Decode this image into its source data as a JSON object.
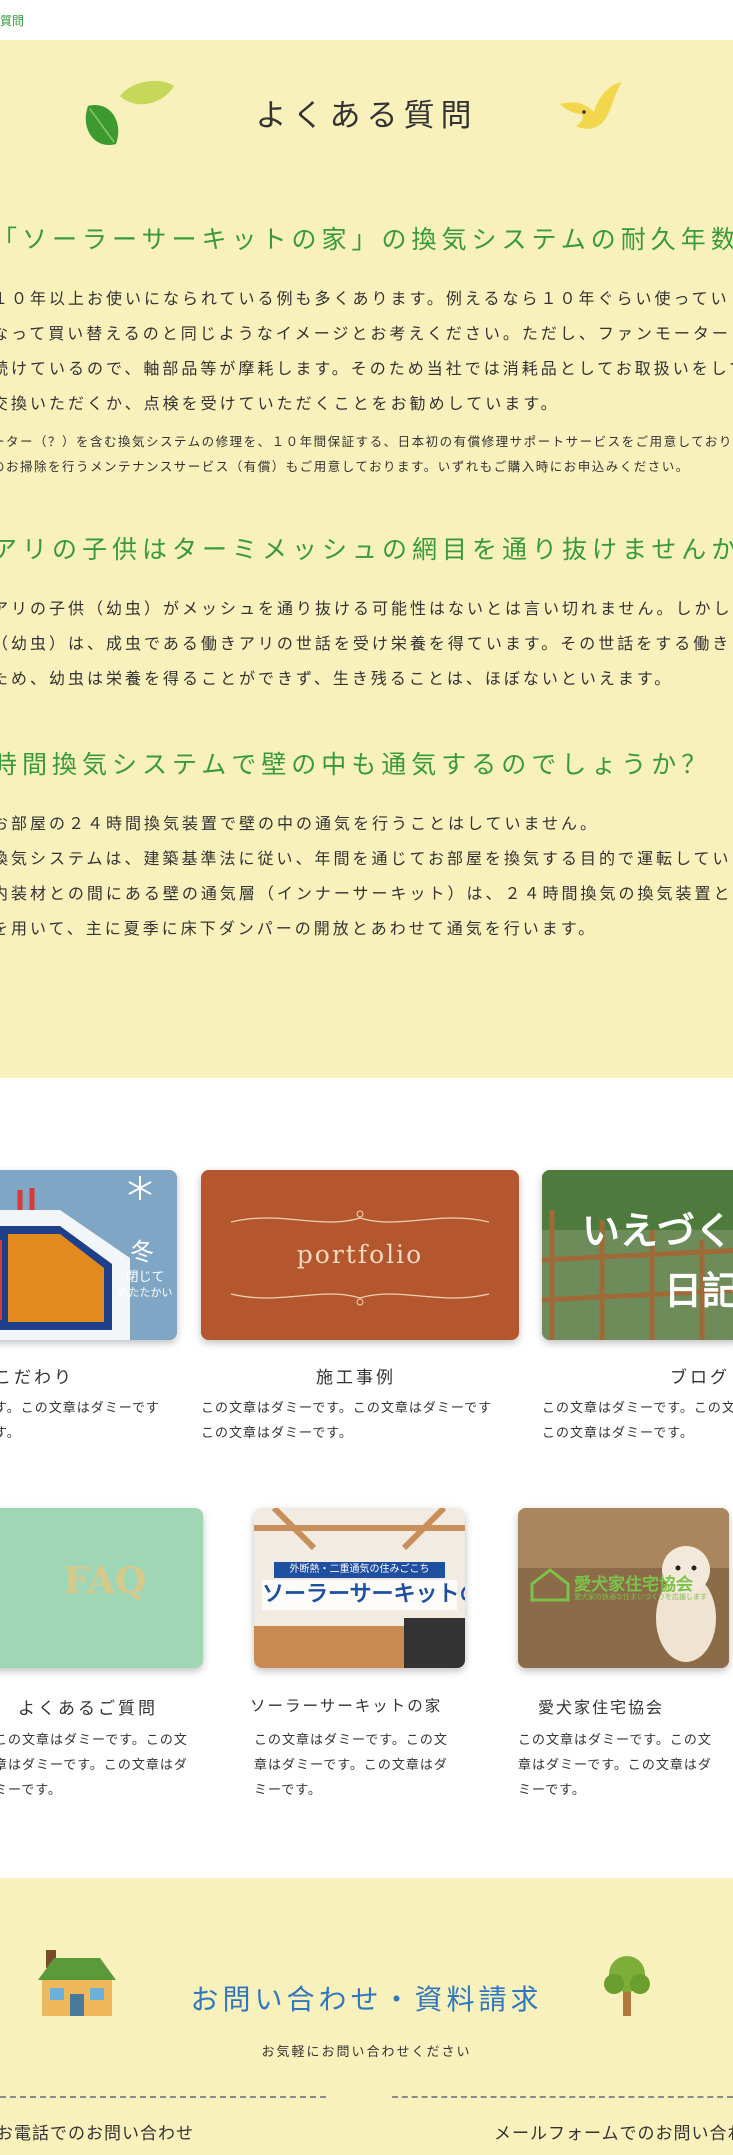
{
  "breadcrumb": "質問",
  "page_title": "よくある質問",
  "faqs": [
    {
      "question": "「ソーラーサーキットの家」の換気システムの耐久年数は？",
      "answer_lines": [
        "１０年以上お使いになられている例も多くあります。例えるなら１０年ぐらい使ってい",
        "なって買い替えるのと同じようなイメージとお考えください。ただし、ファンモーター",
        "続けているので、軸部品等が摩耗します。そのため当社では消耗品としてお取扱いをして",
        "交換いただくか、点検を受けていただくことをお勧めしています。"
      ],
      "note_lines": [
        "ーター（？）を含む換気システムの修理を、１０年間保証する、日本初の有償修理サポートサービスをご用意しております。",
        "のお掃除を行うメンテナンスサービス（有償）もご用意しております。いずれもご購入時にお申込みください。"
      ]
    },
    {
      "question": "アリの子供はターミメッシュの網目を通り抜けませんか",
      "answer_lines": [
        "アリの子供（幼虫）がメッシュを通り抜ける可能性はないとは言い切れません。しかし",
        "（幼虫）は、成虫である働きアリの世話を受け栄養を得ています。その世話をする働きア",
        "ため、幼虫は栄養を得ることができず、生き残ることは、ほぼないといえます。"
      ]
    },
    {
      "question": "時間換気システムで壁の中も通気するのでしょうか？",
      "answer_lines": [
        "お部屋の２４時間換気装置で壁の中の通気を行うことはしていません。",
        "換気システムは、建築基準法に従い、年間を通じてお部屋を換気する目的で運転していま",
        "内装材との間にある壁の通気層（インナーサーキット）は、２４時間換気の換気装置とは",
        "を用いて、主に夏季に床下ダンパーの開放とあわせて通気を行います。"
      ]
    }
  ],
  "cards_row1": [
    {
      "image_text": "冬",
      "image_sub": [
        "閉じて",
        "あたたかい"
      ],
      "title": "こだわり",
      "text_lines": [
        "す。この文章はダミーです",
        "す。"
      ]
    },
    {
      "image_text": "portfolio",
      "title": "施工事例",
      "text_lines": [
        "この文章はダミーです。この文章はダミーです",
        "この文章はダミーです。"
      ]
    },
    {
      "image_text": [
        "いえづく",
        "日記"
      ],
      "title": "ブログ",
      "text_lines": [
        "この文章はダミーです。この文",
        "この文章はダミーです。"
      ]
    }
  ],
  "cards_row2": [
    {
      "image_text": "FAQ",
      "title": "よくあるご質問",
      "text_lines": [
        "この文章はダミーです。この文",
        "章はダミーです。この文章はダ",
        "ミーです。"
      ]
    },
    {
      "image_banner_top": "外断熱・二重通気の住みごこち",
      "image_banner_main": "ソーラーサーキットの家",
      "title": "ソーラーサーキットの家",
      "text_lines": [
        "この文章はダミーです。この文",
        "章はダミーです。この文章はダ",
        "ミーです。"
      ]
    },
    {
      "image_text": "愛犬家住宅協会",
      "image_sub": "愛犬家の快適な住まいづくりを応援します",
      "title": "愛犬家住宅協会",
      "text_lines": [
        "この文章はダミーです。この文",
        "章はダミーです。この文章はダ",
        "ミーです。"
      ]
    }
  ],
  "contact": {
    "title": "お問い合わせ・資料請求",
    "subtitle": "お気軽にお問い合わせください",
    "phone_label": "お電話でのお問い合わせ",
    "mail_label": "メールフォームでのお問い合わせ"
  },
  "colors": {
    "cream": "#f8f1bc",
    "green": "#3a9a3a",
    "blue": "#2f78bf"
  }
}
